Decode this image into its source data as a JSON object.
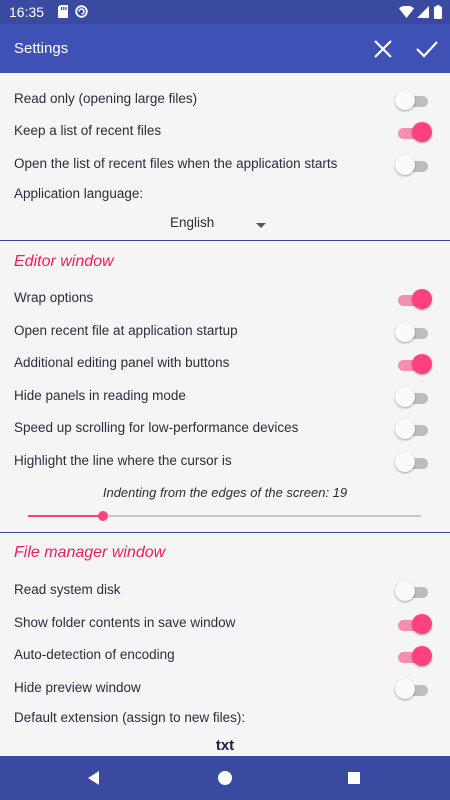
{
  "status_bar": {
    "time": "16:35",
    "icons": [
      "sd-card-icon",
      "sync-icon",
      "wifi-icon",
      "signal-icon",
      "battery-icon"
    ]
  },
  "app_bar": {
    "title": "Settings",
    "close_icon": "close-icon",
    "confirm_icon": "check-icon"
  },
  "general": {
    "read_only": {
      "label": "Read only (opening large files)",
      "on": false
    },
    "recent_list": {
      "label": "Keep a list of recent files",
      "on": true
    },
    "open_recent_on_start": {
      "label": "Open the list of recent files when the application starts",
      "on": false
    },
    "language_label": "Application language:",
    "language_value": "English"
  },
  "editor": {
    "title": "Editor window",
    "wrap": {
      "label": "Wrap options",
      "on": true
    },
    "open_recent_file": {
      "label": "Open recent file at application startup",
      "on": false
    },
    "editing_panel": {
      "label": "Additional editing panel with buttons",
      "on": true
    },
    "hide_panels": {
      "label": "Hide panels in reading mode",
      "on": false
    },
    "speed_scroll": {
      "label": "Speed up scrolling for low-performance devices",
      "on": false
    },
    "highlight_line": {
      "label": "Highlight the line where the cursor is",
      "on": false
    },
    "indent_label": "Indenting from the edges of the screen: 19",
    "indent_value": 19,
    "indent_fraction": 0.19
  },
  "file_manager": {
    "title": "File manager window",
    "system_disk": {
      "label": "Read system disk",
      "on": false
    },
    "folder_contents": {
      "label": "Show folder contents in save window",
      "on": true
    },
    "auto_encoding": {
      "label": "Auto-detection of encoding",
      "on": true
    },
    "hide_preview": {
      "label": "Hide preview window",
      "on": false
    },
    "default_ext_label": "Default extension (assign to new files):",
    "default_ext_value": "txt"
  },
  "nav_bar": {
    "back": "back-icon",
    "home": "home-icon",
    "recents": "recents-icon"
  },
  "colors": {
    "primary": "#3f51b5",
    "primary_dark": "#3a4aa0",
    "accent": "#ff4081",
    "section_title": "#e91e63"
  }
}
